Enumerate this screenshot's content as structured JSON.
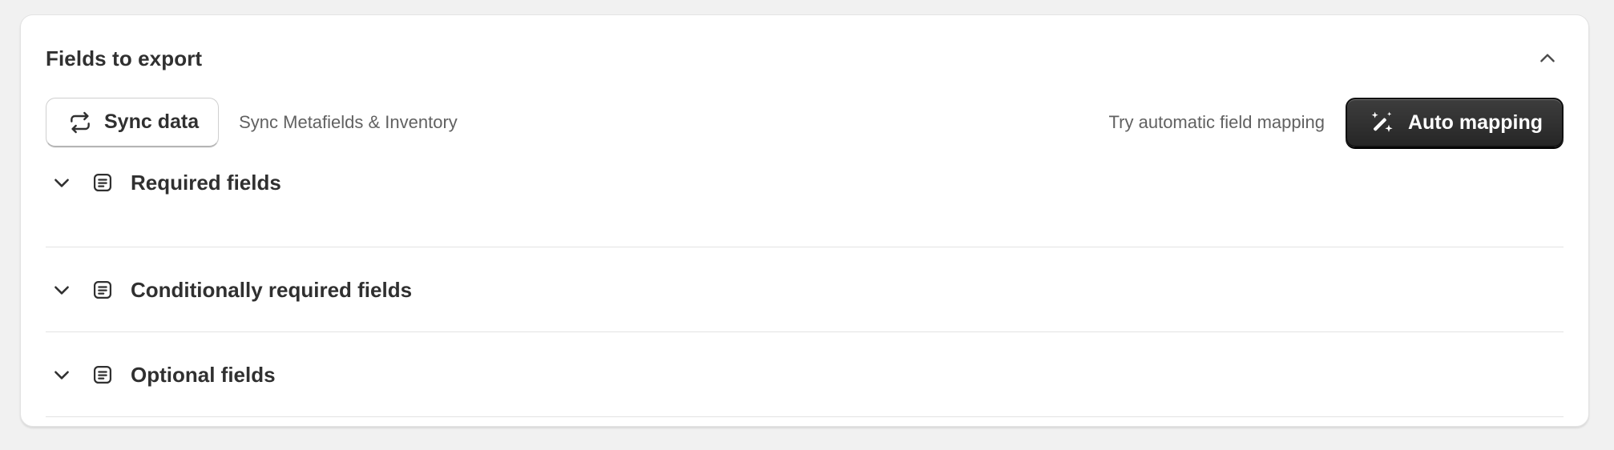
{
  "card": {
    "title": "Fields to export"
  },
  "toolbar": {
    "sync_button_label": "Sync data",
    "sync_note": "Sync Metafields & Inventory",
    "auto_note": "Try automatic field mapping",
    "auto_button_label": "Auto mapping"
  },
  "sections": [
    {
      "label": "Required fields"
    },
    {
      "label": "Conditionally required fields"
    },
    {
      "label": "Optional fields"
    }
  ],
  "icons": {
    "collapse": "chevron-up-icon",
    "sync": "sync-arrows-icon",
    "auto": "magic-wand-icon",
    "expand": "chevron-down-icon",
    "list": "list-document-icon"
  },
  "colors": {
    "background": "#f1f1f1",
    "card": "#ffffff",
    "text": "#303030",
    "muted": "#616161",
    "primary_button": "#303030"
  }
}
